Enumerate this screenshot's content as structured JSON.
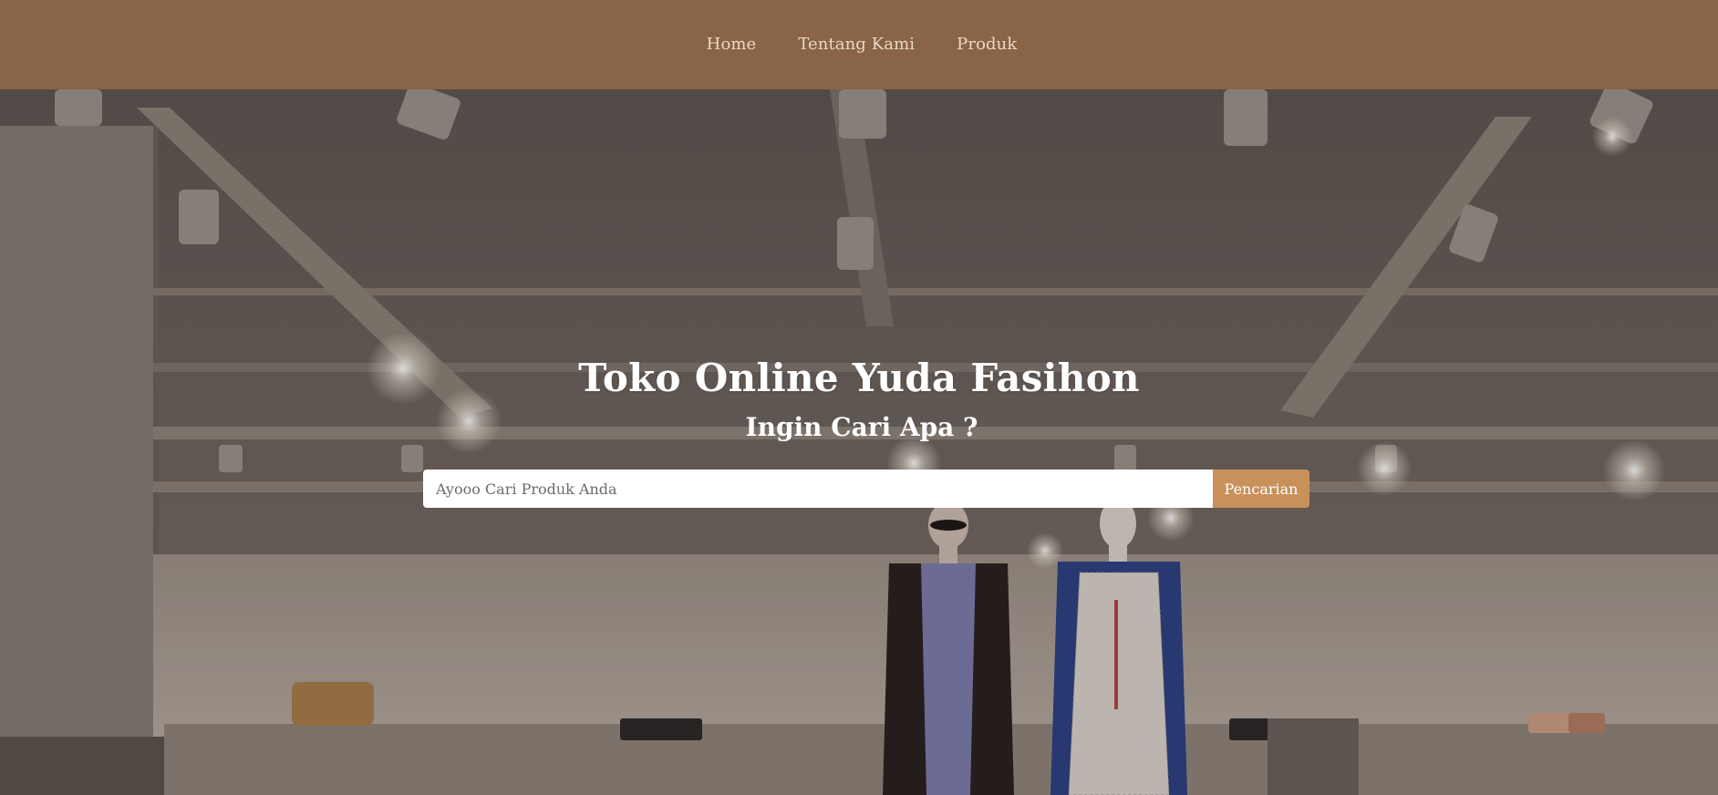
{
  "nav": {
    "items": [
      {
        "label": "Home"
      },
      {
        "label": "Tentang Kami"
      },
      {
        "label": "Produk"
      }
    ]
  },
  "hero": {
    "title": "Toko Online Yuda Fasihon",
    "subtitle": "Ingin Cari Apa ?",
    "search": {
      "placeholder": "Ayooo Cari Produk Anda",
      "value": "",
      "button_label": "Pencarian"
    },
    "background": "fashion-store-interior-photo"
  },
  "colors": {
    "navbar": "#8a6446",
    "nav_text": "#ead8c7",
    "button": "#c8915a",
    "hero_overlay": "#6f655f"
  }
}
